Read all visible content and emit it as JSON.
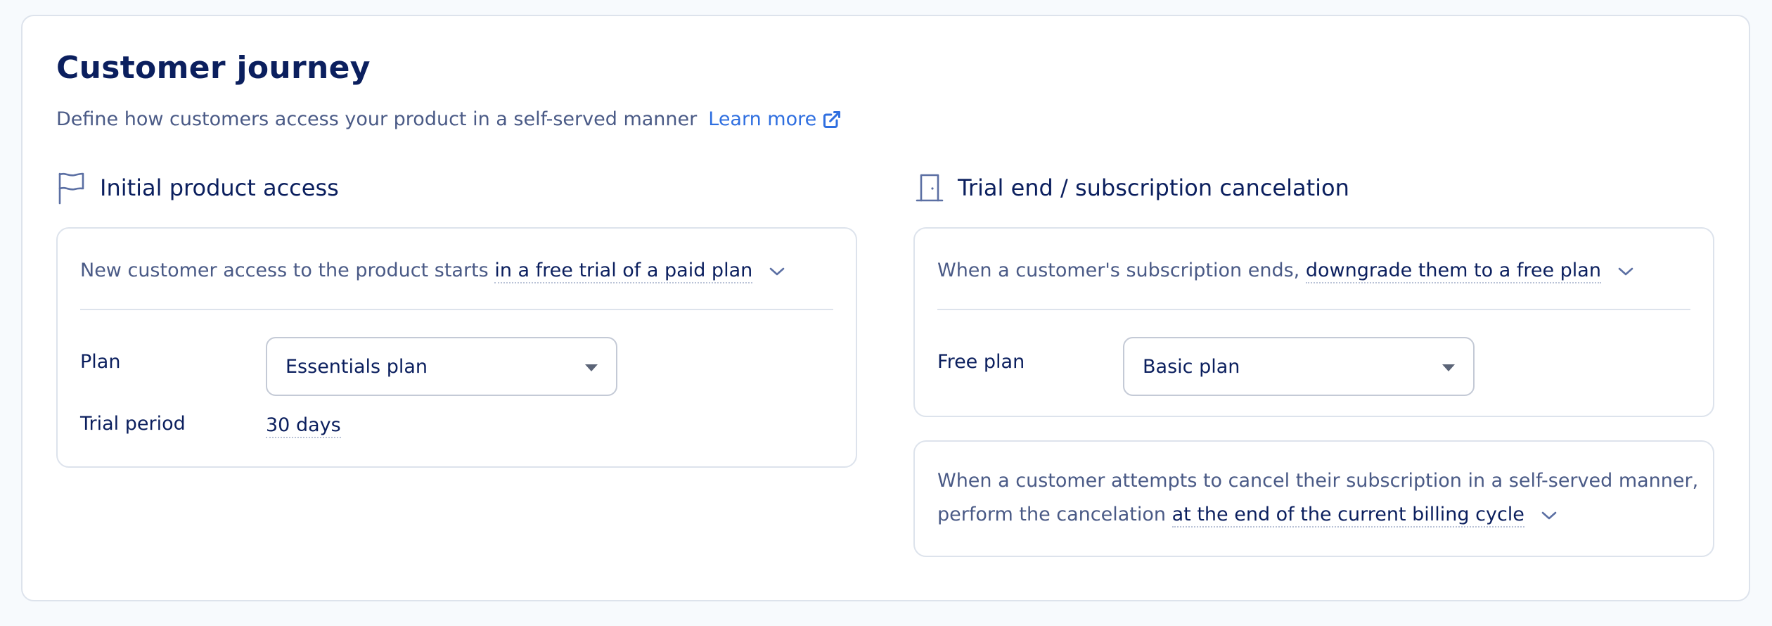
{
  "header": {
    "title": "Customer journey",
    "subtitle": "Define how customers access your product in a self-served manner",
    "learn_more": "Learn more",
    "learn_more_icon": "external-link-icon"
  },
  "initial_access": {
    "heading": "Initial product access",
    "icon": "flag-icon",
    "sentence_prefix": "New customer access to the product starts",
    "sentence_choice": "in a free trial of a paid plan",
    "plan_label": "Plan",
    "plan_value": "Essentials plan",
    "trial_label": "Trial period",
    "trial_value": "30 days"
  },
  "trial_end": {
    "heading": "Trial end / subscription cancelation",
    "icon": "door-icon",
    "sentence_prefix": "When a customer's subscription ends,",
    "sentence_choice": "downgrade them to a free plan",
    "free_plan_label": "Free plan",
    "free_plan_value": "Basic plan"
  },
  "cancelation": {
    "line1": "When a customer attempts to cancel their subscription in a self-served manner,",
    "line2_prefix": "perform the cancelation",
    "line2_choice": "at the end of the current billing cycle"
  },
  "colors": {
    "primary_text": "#0b1f5e",
    "secondary_text": "#4a5a86",
    "link": "#2f6fe0",
    "border": "#dde3ec"
  }
}
